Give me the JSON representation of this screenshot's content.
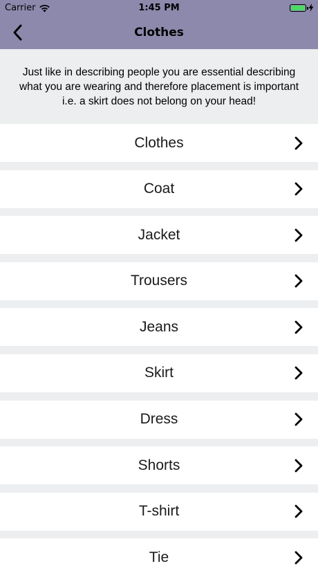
{
  "status_bar": {
    "carrier": "Carrier",
    "time": "1:45 PM",
    "battery_level": 1.0,
    "battery_color": "#4cd964",
    "icons": [
      "wifi-icon",
      "battery-icon",
      "charging-bolt-icon"
    ]
  },
  "nav": {
    "title": "Clothes",
    "back_icon": "chevron-left-icon",
    "background_color": "#8d89ad"
  },
  "intro": {
    "text": "Just like in describing people you are essential describing what you are wearing and therefore placement is important i.e. a skirt does not belong on your head!"
  },
  "list": {
    "item_icon": "chevron-right-icon",
    "items": [
      {
        "label": "Clothes"
      },
      {
        "label": "Coat"
      },
      {
        "label": "Jacket"
      },
      {
        "label": "Trousers"
      },
      {
        "label": "Jeans"
      },
      {
        "label": "Skirt"
      },
      {
        "label": "Dress"
      },
      {
        "label": "Shorts"
      },
      {
        "label": "T-shirt"
      },
      {
        "label": "Tie"
      }
    ]
  }
}
